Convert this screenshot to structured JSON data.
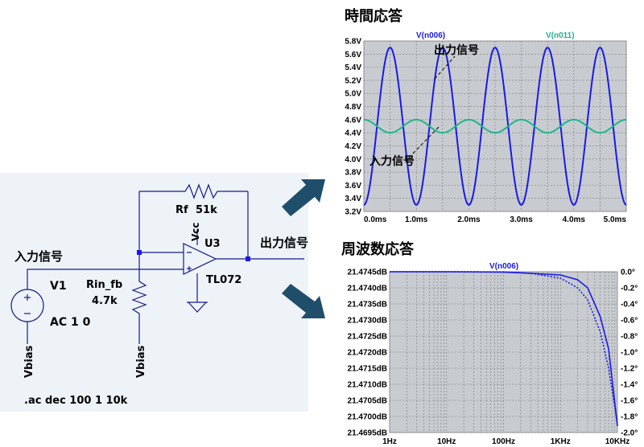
{
  "schematic": {
    "title_input": "入力信号",
    "title_output": "出力信号",
    "v1_name": "V1",
    "v1_value": "AC 1 0",
    "vbias_left": "Vbias",
    "vbias_mid": "Vbias",
    "rin_name": "Rin_fb",
    "rin_value": "4.7k",
    "rf_name": "Rf",
    "rf_value": "51k",
    "opamp_name": "U3",
    "opamp_model": "TL072",
    "vcc": "Vcc",
    "directive": ".ac dec 100 1 10k"
  },
  "colors": {
    "blue": "#1a1ae6",
    "teal": "#20b48c",
    "plot_bg": "#c8ccd0",
    "arrow": "#1f4e6b",
    "schematic_bg": "#eef3f8"
  },
  "time_plot": {
    "heading": "時間応答",
    "legend_a": "V(n006)",
    "legend_b": "V(n011)",
    "annot_out": "出力信号",
    "annot_in": "入力信号",
    "y_ticks": [
      "5.8V",
      "5.6V",
      "5.4V",
      "5.2V",
      "5.0V",
      "4.8V",
      "4.6V",
      "4.4V",
      "4.2V",
      "4.0V",
      "3.8V",
      "3.6V",
      "3.4V",
      "3.2V"
    ],
    "x_ticks": [
      "0.0ms",
      "1.0ms",
      "2.0ms",
      "3.0ms",
      "4.0ms",
      "5.0ms"
    ]
  },
  "freq_plot": {
    "heading": "周波数応答",
    "legend": "V(n006)",
    "y_left_ticks": [
      "21.4745dB",
      "21.4740dB",
      "21.4735dB",
      "21.4730dB",
      "21.4725dB",
      "21.4720dB",
      "21.4715dB",
      "21.4710dB",
      "21.4705dB",
      "21.4700dB",
      "21.4695dB"
    ],
    "y_right_ticks": [
      "0.0°",
      "-0.2°",
      "-0.4°",
      "-0.6°",
      "-0.8°",
      "-1.0°",
      "-1.2°",
      "-1.4°",
      "-1.6°",
      "-1.8°",
      "-2.0°"
    ],
    "x_ticks": [
      "1Hz",
      "10Hz",
      "100Hz",
      "1KHz",
      "10KHz"
    ]
  },
  "chart_data": [
    {
      "type": "line",
      "title": "時間応答",
      "xlabel": "",
      "ylabel": "",
      "x_unit": "ms",
      "xlim": [
        0,
        5
      ],
      "ylim": [
        3.2,
        5.8
      ],
      "grid": true,
      "series": [
        {
          "name": "V(n006)",
          "kind": "sine",
          "offset": 4.5,
          "amplitude": 1.2,
          "frequency_khz": 1,
          "phase_deg": -90
        },
        {
          "name": "V(n011)",
          "kind": "sine",
          "offset": 4.5,
          "amplitude": 0.1,
          "frequency_khz": 1,
          "phase_deg": 90
        }
      ]
    },
    {
      "type": "line",
      "title": "周波数応答",
      "xlabel": "",
      "ylabel": "",
      "x_scale": "log",
      "xlim": [
        1,
        10000
      ],
      "ylim": [
        21.4695,
        21.4745
      ],
      "y2lim": [
        -2.0,
        0.0
      ],
      "grid": true,
      "series": [
        {
          "name": "V(n006)",
          "axis": "left",
          "style": "solid",
          "x": [
            1,
            10,
            100,
            300,
            1000,
            2000,
            3000,
            5000,
            7000,
            10000
          ],
          "y": [
            21.4745,
            21.4745,
            21.47449,
            21.47445,
            21.4744,
            21.47425,
            21.474,
            21.4731,
            21.4721,
            21.4697
          ]
        },
        {
          "name": "",
          "axis": "right",
          "style": "dotted",
          "x": [
            1,
            10,
            100,
            300,
            1000,
            2000,
            3000,
            5000,
            7000,
            10000
          ],
          "y": [
            0.0,
            0.0,
            -0.002,
            -0.02,
            -0.08,
            -0.2,
            -0.35,
            -0.75,
            -1.2,
            -1.9
          ]
        }
      ]
    }
  ]
}
